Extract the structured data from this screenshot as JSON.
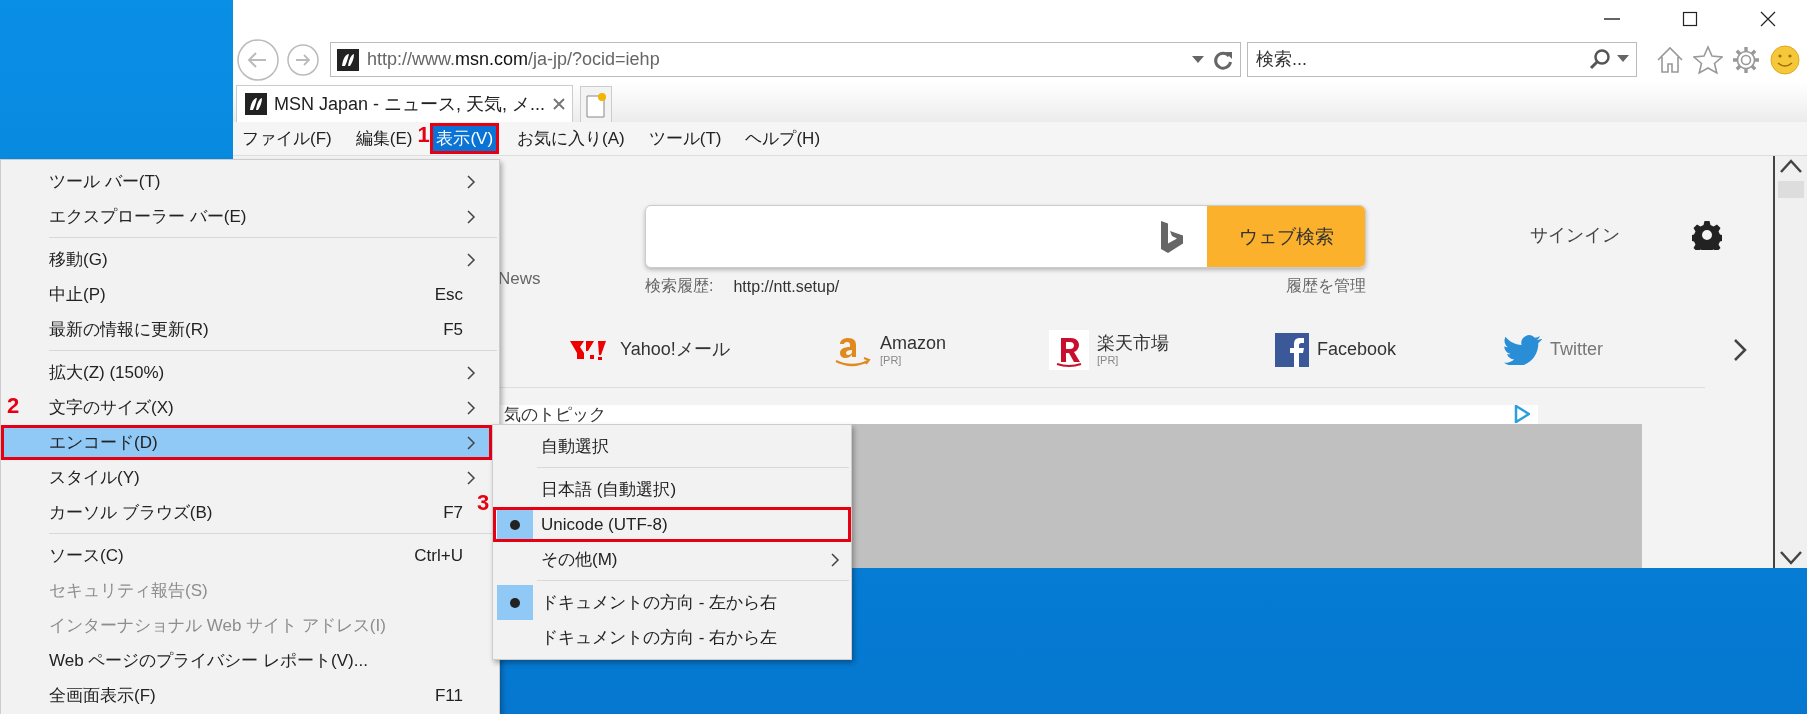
{
  "address_bar": {
    "url": "http://www.**msn.com**/ja-jp/?ocid=iehp"
  },
  "search_box": {
    "placeholder": "検索..."
  },
  "tabs": [
    {
      "label": "MSN Japan - ニュース, 天気, メ...",
      "selected": true
    }
  ],
  "menu_bar": [
    {
      "label": "ファイル(F)",
      "selected": false
    },
    {
      "label": "編集(E)",
      "selected": false
    },
    {
      "label": "表示(V)",
      "selected": true,
      "step": "1"
    },
    {
      "label": "お気に入り(A)",
      "selected": false
    },
    {
      "label": "ツール(T)",
      "selected": false
    },
    {
      "label": "ヘルプ(H)",
      "selected": false
    }
  ],
  "page": {
    "news_label": "News",
    "search_button": "ウェブ検索",
    "history_label": "検索履歴:",
    "history_url": "http://ntt.setup/",
    "manage_history": "履歴を管理",
    "sign_in": "サインイン",
    "quick_links": [
      {
        "kind": "yahoo",
        "label": "Yahoo!メール"
      },
      {
        "kind": "amazon",
        "label": "Amazon",
        "note": "[PR]"
      },
      {
        "kind": "rakuten",
        "label": "楽天市場",
        "note": "[PR]"
      },
      {
        "kind": "facebook",
        "label": "Facebook"
      },
      {
        "kind": "twitter",
        "label": "Twitter"
      }
    ],
    "topic_heading": "気のトピック"
  },
  "view_menu": [
    {
      "kind": "item",
      "label": "ツール バー(T)",
      "submenu": true,
      "selected": false,
      "disabled": false
    },
    {
      "kind": "item",
      "label": "エクスプローラー バー(E)",
      "submenu": true,
      "selected": false,
      "disabled": false
    },
    {
      "kind": "separator"
    },
    {
      "kind": "item",
      "label": "移動(G)",
      "submenu": true,
      "selected": false,
      "disabled": false
    },
    {
      "kind": "item",
      "label": "中止(P)",
      "shortcut": "Esc",
      "submenu": false,
      "selected": false,
      "disabled": false
    },
    {
      "kind": "item",
      "label": "最新の情報に更新(R)",
      "shortcut": "F5",
      "submenu": false,
      "selected": false,
      "disabled": false
    },
    {
      "kind": "separator"
    },
    {
      "kind": "item",
      "label": "拡大(Z) (150%)",
      "submenu": true,
      "selected": false,
      "disabled": false
    },
    {
      "kind": "item",
      "label": "文字のサイズ(X)",
      "submenu": true,
      "selected": false,
      "disabled": false
    },
    {
      "kind": "item",
      "label": "エンコード(D)",
      "submenu": true,
      "selected": true,
      "disabled": false,
      "step": "2"
    },
    {
      "kind": "item",
      "label": "スタイル(Y)",
      "submenu": true,
      "selected": false,
      "disabled": false
    },
    {
      "kind": "item",
      "label": "カーソル ブラウズ(B)",
      "shortcut": "F7",
      "submenu": false,
      "selected": false,
      "disabled": false
    },
    {
      "kind": "separator"
    },
    {
      "kind": "item",
      "label": "ソース(C)",
      "shortcut": "Ctrl+U",
      "submenu": false,
      "selected": false,
      "disabled": false
    },
    {
      "kind": "item",
      "label": "セキュリティ報告(S)",
      "submenu": false,
      "selected": false,
      "disabled": true
    },
    {
      "kind": "item",
      "label": "インターナショナル Web サイト アドレス(I)",
      "submenu": false,
      "selected": false,
      "disabled": true
    },
    {
      "kind": "item",
      "label": "Web ページのプライバシー レポート(V)...",
      "submenu": false,
      "selected": false,
      "disabled": false
    },
    {
      "kind": "item",
      "label": "全画面表示(F)",
      "shortcut": "F11",
      "submenu": false,
      "selected": false,
      "disabled": false
    }
  ],
  "encoding_submenu": [
    {
      "kind": "item",
      "label": "自動選択",
      "checked": false,
      "submenu": false
    },
    {
      "kind": "separator"
    },
    {
      "kind": "item",
      "label": "日本語 (自動選択)",
      "checked": false,
      "submenu": false
    },
    {
      "kind": "item",
      "label": "Unicode (UTF-8)",
      "checked": true,
      "submenu": false,
      "step": "3"
    },
    {
      "kind": "item",
      "label": "その他(M)",
      "checked": false,
      "submenu": true
    },
    {
      "kind": "separator"
    },
    {
      "kind": "item",
      "label": "ドキュメントの方向 - 左から右",
      "checked": true,
      "submenu": false
    },
    {
      "kind": "item",
      "label": "ドキュメントの方向 - 右から左",
      "checked": false,
      "submenu": false
    }
  ]
}
